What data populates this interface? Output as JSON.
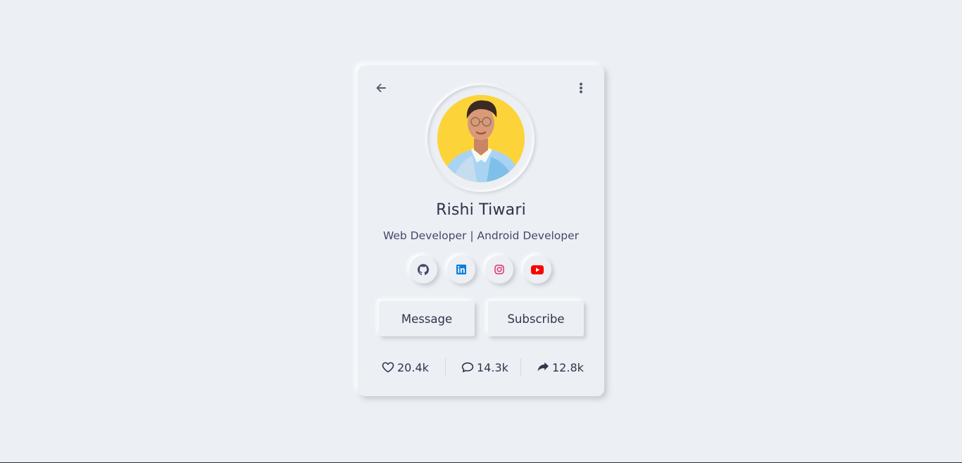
{
  "profile": {
    "name": "Rishi Tiwari",
    "role": "Web Developer | Android Developer"
  },
  "header": {
    "back_icon": "arrow-left-icon",
    "more_icon": "vertical-dots-icon"
  },
  "socials": [
    {
      "name": "github",
      "icon": "github-icon",
      "color": "#44476a"
    },
    {
      "name": "linkedin",
      "icon": "linkedin-icon",
      "color": "#0a7fe0"
    },
    {
      "name": "instagram",
      "icon": "instagram-icon",
      "color": "#e1306c"
    },
    {
      "name": "youtube",
      "icon": "youtube-icon",
      "color": "#ff0000"
    }
  ],
  "actions": {
    "message_label": "Message",
    "subscribe_label": "Subscribe"
  },
  "stats": {
    "likes": "20.4k",
    "comments": "14.3k",
    "shares": "12.8k"
  },
  "colors": {
    "background": "#eceff3",
    "text": "#31344b",
    "avatar_bg": "#fcd43a"
  }
}
